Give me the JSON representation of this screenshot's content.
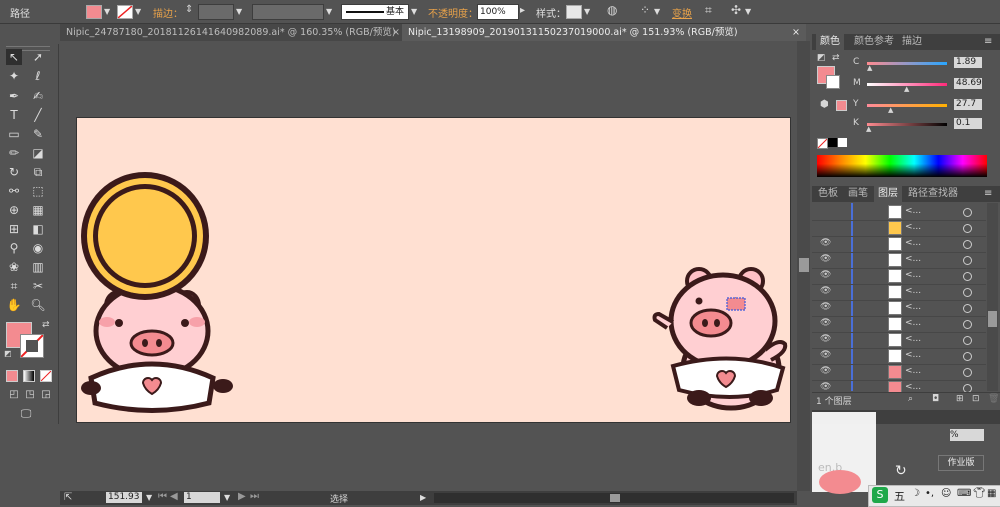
{
  "control_bar": {
    "path_label": "路径",
    "stroke_label": "描边：",
    "stroke_style": "基本",
    "opacity_label": "不透明度：",
    "opacity_value": "100%",
    "style_label": "样式：",
    "transform_label": "变换"
  },
  "tabs": [
    {
      "label": "Nipic_24787180_20181126141640982089.ai* @ 160.35% (RGB/预览)",
      "close": "×"
    },
    {
      "label": "Nipic_13198909_20190131150237019000.ai* @ 151.93% (RGB/预览)",
      "close": "×"
    }
  ],
  "color_panel": {
    "tabs": [
      "颜色",
      "颜色参考",
      "描边"
    ],
    "channels": [
      {
        "name": "C",
        "value": "1.89",
        "percent": 1.89
      },
      {
        "name": "M",
        "value": "48.69",
        "percent": 48.69
      },
      {
        "name": "Y",
        "value": "27.7",
        "percent": 27.7
      },
      {
        "name": "K",
        "value": "0.1",
        "percent": 0.1
      }
    ],
    "fill_color": "#f38b90"
  },
  "layers_panel": {
    "tabs": [
      "色板",
      "画笔",
      "图层",
      "路径查找器"
    ],
    "rows": [
      {
        "label": "<...",
        "visible": false
      },
      {
        "label": "<...",
        "visible": false
      },
      {
        "label": "<...",
        "visible": true
      },
      {
        "label": "<...",
        "visible": true
      },
      {
        "label": "<...",
        "visible": true
      },
      {
        "label": "<...",
        "visible": true
      },
      {
        "label": "<...",
        "visible": true
      },
      {
        "label": "<...",
        "visible": true
      },
      {
        "label": "<...",
        "visible": true
      },
      {
        "label": "<...",
        "visible": true
      },
      {
        "label": "<...",
        "visible": true
      },
      {
        "label": "<...",
        "visible": true
      }
    ],
    "footer": "1 个图层"
  },
  "lower_panel": {
    "percent": "%",
    "workspace_label": "作业版",
    "ime_label": "五",
    "partial_text": "en.b"
  },
  "status_bar": {
    "zoom": "151.93",
    "artboard_number": "1",
    "tool": "选择"
  },
  "colors": {
    "ui_bg": "#535353",
    "artboard": "#ffe0d2",
    "accent_orange": "#e8a24a",
    "fill": "#f38b90"
  }
}
